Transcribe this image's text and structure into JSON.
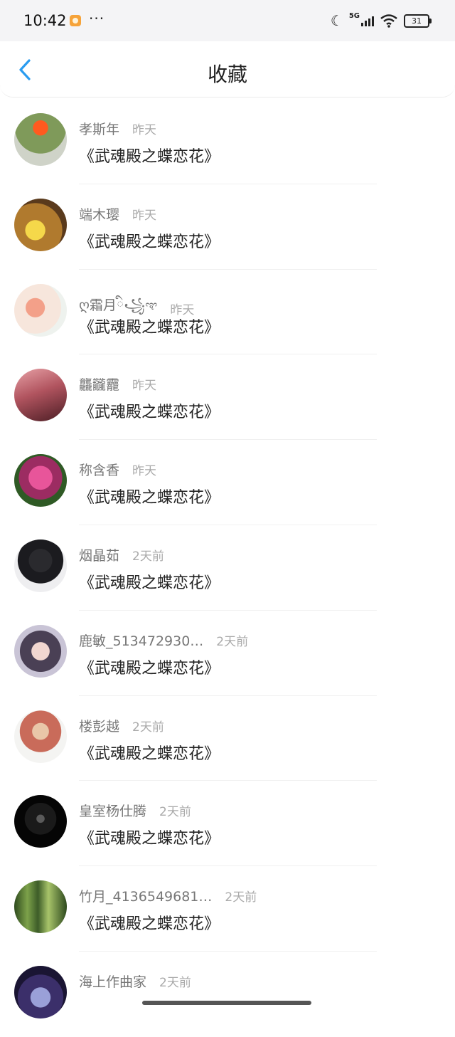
{
  "status": {
    "time": "10:42",
    "dots": "···",
    "network": "5G",
    "battery": "31"
  },
  "header": {
    "title": "收藏"
  },
  "items": [
    {
      "user": "孝斯年",
      "time": "昨天",
      "title": "《武魂殿之蝶恋花》"
    },
    {
      "user": "端木璎",
      "time": "昨天",
      "title": "《武魂殿之蝶恋花》"
    },
    {
      "user": "ღ霜月ི꧁ಞ",
      "time": "昨天",
      "title": "《武魂殿之蝶恋花》"
    },
    {
      "user": "龘龖龗",
      "time": "昨天",
      "title": "《武魂殿之蝶恋花》"
    },
    {
      "user": "称含香",
      "time": "昨天",
      "title": "《武魂殿之蝶恋花》"
    },
    {
      "user": "烟晶茹",
      "time": "2天前",
      "title": "《武魂殿之蝶恋花》"
    },
    {
      "user": "鹿敏_513472930…",
      "time": "2天前",
      "title": "《武魂殿之蝶恋花》"
    },
    {
      "user": "楼彭越",
      "time": "2天前",
      "title": "《武魂殿之蝶恋花》"
    },
    {
      "user": "皇室杨仕腾",
      "time": "2天前",
      "title": "《武魂殿之蝶恋花》"
    },
    {
      "user": "竹月_4136549681…",
      "time": "2天前",
      "title": "《武魂殿之蝶恋花》"
    },
    {
      "user": "海上作曲家",
      "time": "2天前",
      "title": ""
    }
  ],
  "colors": {
    "accent": "#2a9cf0",
    "name": "#777777",
    "time": "#aaaaaa",
    "title": "#222222"
  }
}
